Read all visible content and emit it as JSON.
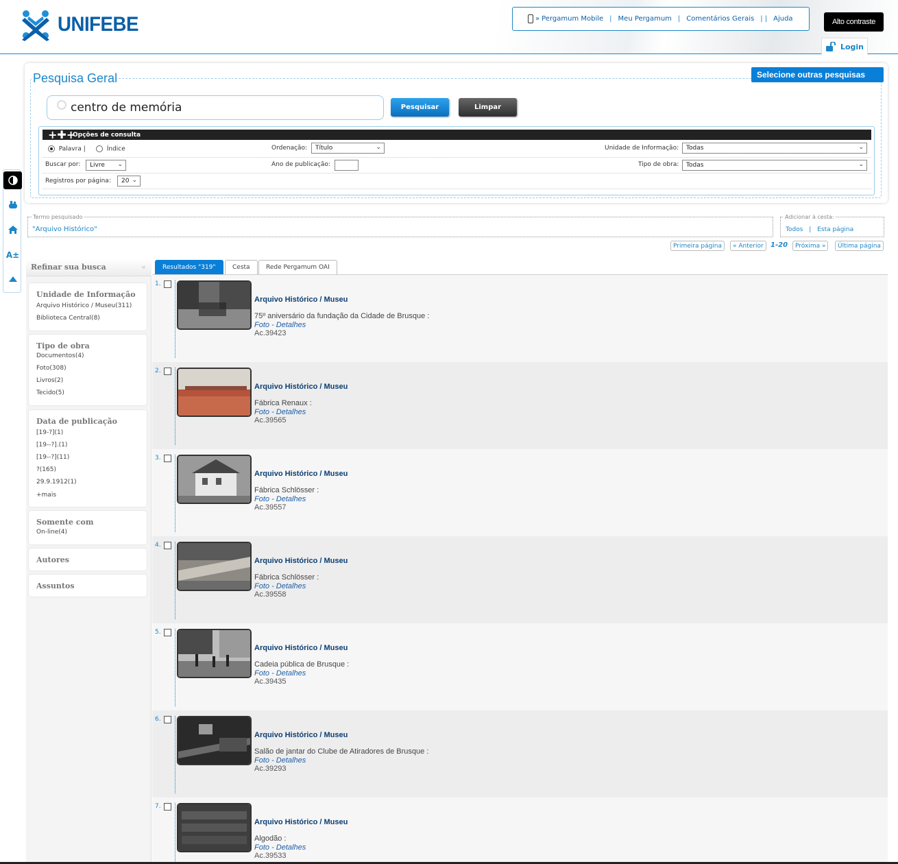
{
  "header": {
    "logo_text": "UNIFEBE",
    "links": [
      "Pergamum Mobile",
      "Meu Pergamum",
      "Comentários Gerais",
      "Ajuda"
    ],
    "mobile_prefix": "»",
    "contrast_label": "Alto contraste",
    "login_label": "Login"
  },
  "search": {
    "panel_title": "Pesquisa Geral",
    "select_other": "Selecione outras pesquisas",
    "query": "centro de memória",
    "btn_search": "Pesquisar",
    "btn_clear": "Limpar"
  },
  "options": {
    "title": "Opções de consulta",
    "radio_word": "Palavra",
    "radio_index": "Índice",
    "sep": "|",
    "ordenacao_label": "Ordenação:",
    "ordenacao_value": "Título",
    "unidade_label": "Unidade de Informação:",
    "unidade_value": "Todas",
    "buscar_label": "Buscar por:",
    "buscar_value": "Livre",
    "ano_label": "Ano de publicação:",
    "ano_value": "",
    "tipo_label": "Tipo de obra:",
    "tipo_value": "Todas",
    "registros_label": "Registros por página:",
    "registros_value": "20"
  },
  "termo": {
    "legend": "Termo pesquisado",
    "value": "\"Arquivo Histórico\"",
    "cesta_legend": "Adicionar à cesta:",
    "cesta_all": "Todos",
    "cesta_page": "Esta página"
  },
  "pager": {
    "first": "Primeira página",
    "prev": "« Anterior",
    "current": "1-20",
    "next": "Próxima »",
    "last": "Última página"
  },
  "refine": {
    "title": "Refinar sua busca",
    "groups": [
      {
        "title": "Unidade de Informação",
        "items": [
          "Arquivo Histórico / Museu(311)",
          "Biblioteca Central(8)"
        ]
      },
      {
        "title": "Tipo de obra",
        "items": [
          "Documentos(4)",
          "Foto(308)",
          "Livros(2)",
          "Tecido(5)"
        ]
      },
      {
        "title": "Data de publicação",
        "items": [
          "[19-?](1)",
          "[19--?].(1)",
          "[19--?](11)",
          "?(165)",
          "29.9.1912(1)",
          "+mais"
        ]
      },
      {
        "title": "Somente com",
        "items": [
          "On-line(4)"
        ]
      },
      {
        "title": "Autores",
        "items": []
      },
      {
        "title": "Assuntos",
        "items": []
      }
    ]
  },
  "tabs": [
    "Resultados \"319\"",
    "Cesta",
    "Rede Pergamum OAI"
  ],
  "results": [
    {
      "num": "1.",
      "collection": "Arquivo Histórico / Museu",
      "title": "75º aniversário da fundação da Cidade de Brusque :",
      "type": "Foto - Detalhes",
      "acc": "Ac.39423"
    },
    {
      "num": "2.",
      "collection": "Arquivo Histórico / Museu",
      "title": "Fábrica Renaux :",
      "type": "Foto - Detalhes",
      "acc": "Ac.39565"
    },
    {
      "num": "3.",
      "collection": "Arquivo Histórico / Museu",
      "title": "Fábrica Schlösser :",
      "type": "Foto - Detalhes",
      "acc": "Ac.39557"
    },
    {
      "num": "4.",
      "collection": "Arquivo Histórico / Museu",
      "title": "Fábrica Schlösser :",
      "type": "Foto - Detalhes",
      "acc": "Ac.39558"
    },
    {
      "num": "5.",
      "collection": "Arquivo Histórico / Museu",
      "title": "Cadeia pública de Brusque :",
      "type": "Foto - Detalhes",
      "acc": "Ac.39435"
    },
    {
      "num": "6.",
      "collection": "Arquivo Histórico / Museu",
      "title": "Salão de jantar do Clube de Atiradores de Brusque :",
      "type": "Foto - Detalhes",
      "acc": "Ac.39293"
    },
    {
      "num": "7.",
      "collection": "Arquivo Histórico / Museu",
      "title": "Algodão :",
      "type": "Foto - Detalhes",
      "acc": "Ac.39533"
    }
  ]
}
